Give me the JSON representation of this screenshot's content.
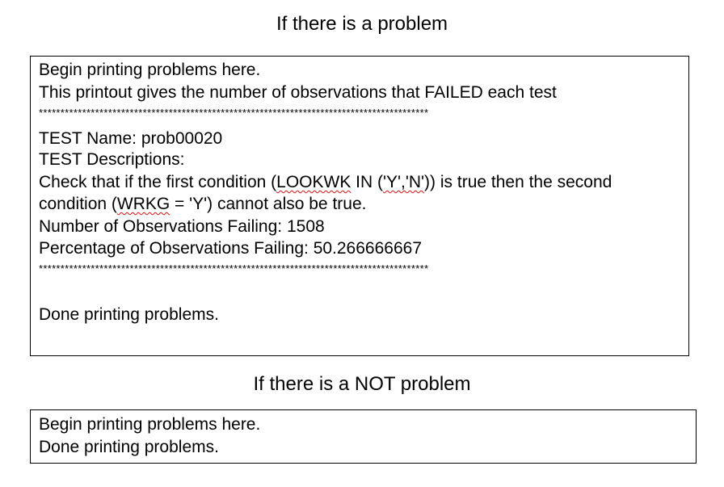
{
  "problem_section": {
    "heading": "If there is a problem",
    "begin": "Begin printing problems here.",
    "intro": "This printout gives the number of observations that FAILED each test",
    "separator": "******************************************************************************************",
    "test_name_label": "TEST Name:  ",
    "test_name": "prob00020",
    "descriptions_label": "TEST Descriptions:",
    "desc_line1_a": "Check that if the first condition (",
    "desc_line1_b": "LOOKWK",
    "desc_line1_c": "  IN (",
    "desc_line1_d": "'Y','N'",
    "desc_line1_e": ")) is true then the second",
    "desc_line2_a": "condition (",
    "desc_line2_b": "WRKG",
    "desc_line2_c": " = 'Y') cannot also be true.",
    "failing_label": "Number of Observations Failing:  ",
    "failing_count": "1508",
    "percentage_label": "Percentage of Observations Failing:  ",
    "percentage_value": "50.266666667",
    "done": "Done printing problems."
  },
  "no_problem_section": {
    "heading": "If there is a NOT problem",
    "begin": "Begin printing problems here.",
    "done": "Done printing problems."
  },
  "colors": {
    "text": "#000000",
    "border": "#000000",
    "spellcheck_underline": "#d01010"
  }
}
